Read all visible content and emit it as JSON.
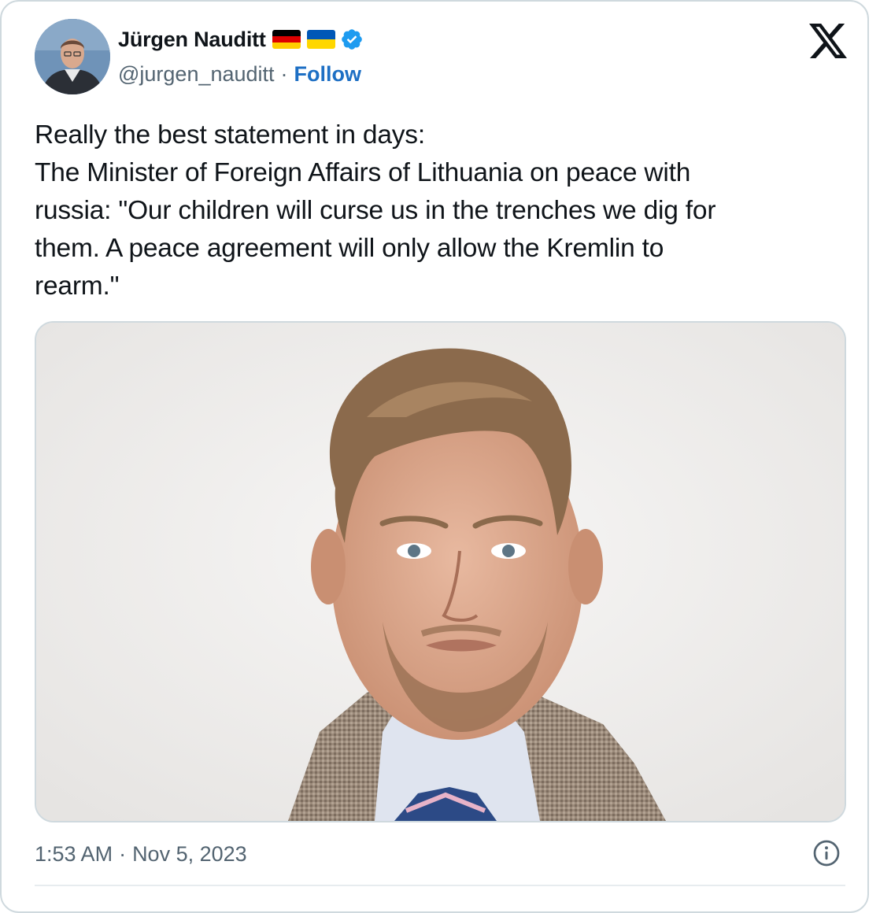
{
  "author": {
    "display_name": "Jürgen Nauditt",
    "handle": "@jurgen_nauditt",
    "separator": "·",
    "follow_label": "Follow",
    "flags": [
      "germany-flag",
      "ukraine-flag"
    ],
    "verified": true
  },
  "tweet": {
    "lines": [
      "Really the best statement in days:",
      "The Minister of Foreign Affairs of Lithuania on peace with",
      "russia: \"Our children will curse us in the trenches we dig for",
      "them. A peace agreement will only allow the Kremlin to",
      "rearm.\""
    ]
  },
  "meta": {
    "time": "1:53 AM",
    "separator": "·",
    "date": "Nov 5, 2023"
  },
  "icons": {
    "brand": "x-logo-icon",
    "info": "info-icon",
    "verified": "verified-badge-icon"
  },
  "colors": {
    "link": "#1d6fc4",
    "verified": "#1d9bf0",
    "secondary_text": "#536471",
    "border": "#cfd9de"
  }
}
